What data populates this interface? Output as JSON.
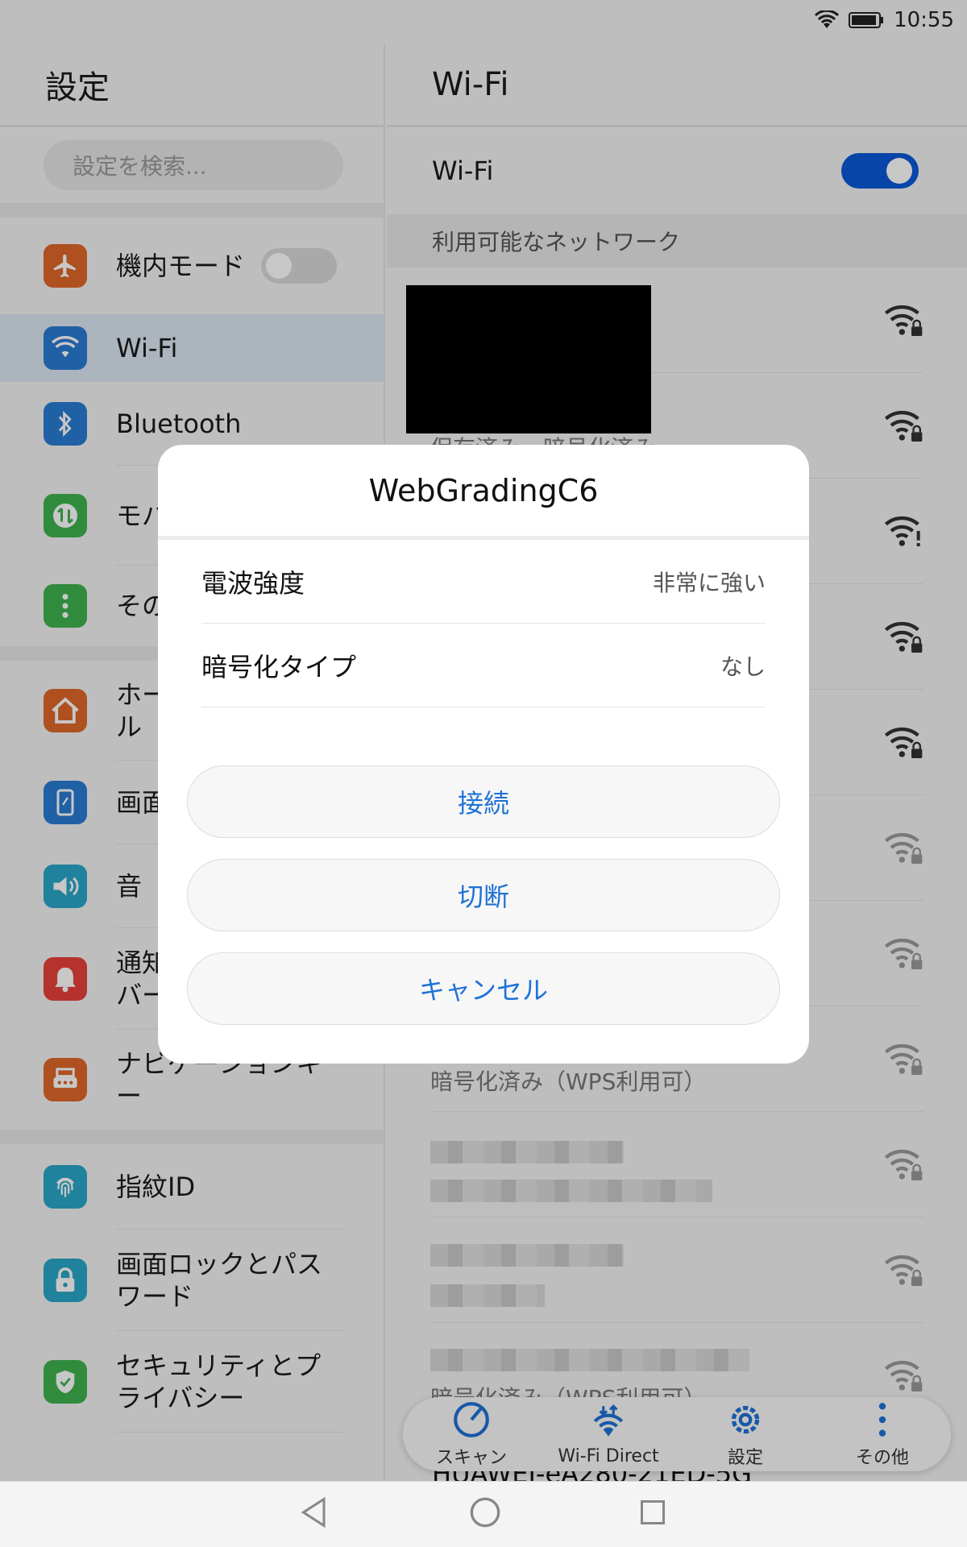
{
  "status": {
    "time": "10:55"
  },
  "left": {
    "title": "設定",
    "search_placeholder": "設定を検索...",
    "items": [
      {
        "label": "機内モード",
        "icon": "airplane-icon",
        "color": "#e0672a"
      },
      {
        "label": "Wi-Fi",
        "icon": "wifi-icon",
        "color": "#2a7bd4"
      },
      {
        "label": "Bluetooth",
        "icon": "bluetooth-icon",
        "color": "#2a7bd4"
      },
      {
        "label": "モバイル通信",
        "icon": "mobile-data-icon",
        "color": "#3fb34f"
      },
      {
        "label": "その他",
        "icon": "more-icon",
        "color": "#3fb34f"
      },
      {
        "label": "ホーム画面スタイル",
        "icon": "home-icon",
        "color": "#e0672a"
      },
      {
        "label": "画面",
        "icon": "display-icon",
        "color": "#2a7bd4"
      },
      {
        "label": "音",
        "icon": "sound-icon",
        "color": "#2aa7c8"
      },
      {
        "label": "通知とステータスバー",
        "icon": "bell-icon",
        "color": "#e8403a"
      },
      {
        "label": "ナビゲーションキー",
        "icon": "navigation-key-icon",
        "color": "#e0672a"
      },
      {
        "label": "指紋ID",
        "icon": "fingerprint-icon",
        "color": "#2aa7c8"
      },
      {
        "label": "画面ロックとパスワード",
        "icon": "lock-icon",
        "color": "#2aa7c8"
      },
      {
        "label": "セキュリティとプライバシー",
        "icon": "shield-icon",
        "color": "#3fb34f"
      }
    ]
  },
  "right": {
    "title": "Wi-Fi",
    "wifi_label": "Wi-Fi",
    "section": "利用可能なネットワーク",
    "networks": [
      {
        "sub": ""
      },
      {
        "sub": "保存済み、暗号化済み"
      },
      {
        "sub": ""
      },
      {
        "sub": ""
      },
      {
        "sub": ""
      },
      {
        "sub": ""
      },
      {
        "sub": ""
      },
      {
        "sub": "暗号化済み（WPS利用可）"
      },
      {
        "sub": ""
      },
      {
        "sub": ""
      },
      {
        "sub": "暗号化済み（WPS利用可）"
      }
    ],
    "partial_network": "HUAWEI-eA280-21ED-5G"
  },
  "toolbar": {
    "scan": "スキャン",
    "wifi_direct": "Wi-Fi Direct",
    "settings": "設定",
    "more": "その他"
  },
  "dialog": {
    "title": "WebGradingC6",
    "rows": [
      {
        "key": "電波強度",
        "value": "非常に強い"
      },
      {
        "key": "暗号化タイプ",
        "value": "なし"
      }
    ],
    "connect": "接続",
    "disconnect": "切断",
    "cancel": "キャンセル"
  },
  "colors": {
    "accent": "#1e72d6",
    "toggle_on": "#0a59d9"
  }
}
